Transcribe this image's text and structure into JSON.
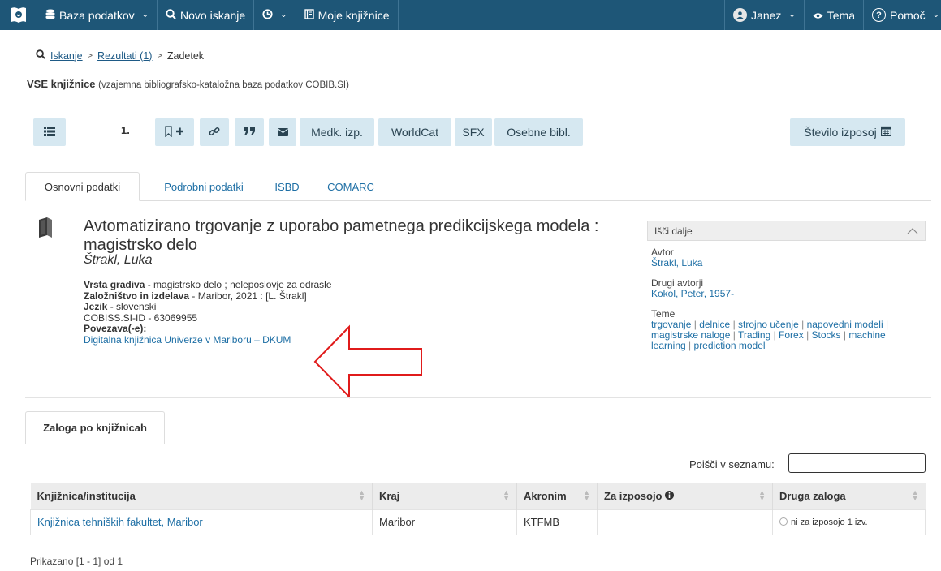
{
  "nav": {
    "database": "Baza podatkov",
    "new_search": "Novo iskanje",
    "my_libraries": "Moje knjižnice",
    "user": "Janez",
    "theme": "Tema",
    "help": "Pomoč"
  },
  "breadcrumb": {
    "search": "Iskanje",
    "results": "Rezultati (1)",
    "hit": "Zadetek"
  },
  "database": {
    "name": "VSE knjižnice",
    "description": "(vzajemna bibliografsko-kataložna baza podatkov COBIB.SI)"
  },
  "toolbar": {
    "record_number": "1.",
    "medk": "Medk. izp.",
    "worldcat": "WorldCat",
    "sfx": "SFX",
    "personal_bibl": "Osebne bibl.",
    "loan_count": "Število izposoj"
  },
  "tabs": {
    "basic": "Osnovni podatki",
    "detailed": "Podrobni podatki",
    "isbd": "ISBD",
    "comarc": "COMARC"
  },
  "record": {
    "title": "Avtomatizirano trgovanje z uporabo pametnega predikcijskega modela : magistrsko delo",
    "author": "Štrakl, Luka",
    "type_label": "Vrsta gradiva",
    "type_value": "- magistrsko delo ; neleposlovje za odrasle",
    "publisher_label": "Založništvo in izdelava",
    "publisher_value": "- Maribor, 2021 : [L. Štrakl]",
    "language_label": "Jezik",
    "language_value": "- slovenski",
    "cobiss_id": "COBISS.SI-ID - 63069955",
    "links_label": "Povezava(-e):",
    "link_text": "Digitalna knjižnica Univerze v Mariboru – DKUM"
  },
  "sidebar": {
    "search_further": "Išči dalje",
    "author_label": "Avtor",
    "author_value": "Štrakl, Luka",
    "other_authors_label": "Drugi avtorji",
    "other_authors_value": "Kokol, Peter, 1957-",
    "topics_label": "Teme",
    "topics": [
      "trgovanje",
      "delnice",
      "strojno učenje",
      "napovedni modeli",
      "magistrske naloge",
      "Trading",
      "Forex",
      "Stocks",
      "machine learning",
      "prediction model"
    ]
  },
  "holdings": {
    "tab": "Zaloga po knjižnicah",
    "search_label": "Poišči v seznamu:",
    "columns": [
      "Knjižnica/institucija",
      "Kraj",
      "Akronim",
      "Za izposojo",
      "Druga zaloga"
    ],
    "rows": [
      {
        "library": "Knjižnica tehniških fakultet, Maribor",
        "city": "Maribor",
        "acronym": "KTFMB",
        "for_loan": "",
        "other": "ni za izposojo 1 izv."
      }
    ],
    "count": "Prikazano [1 - 1] od 1"
  },
  "colors": {
    "navbar": "#1e5677",
    "toolbar_button": "#d6e8f1",
    "link": "#1e6fa5",
    "arrow": "#e01b1b"
  }
}
